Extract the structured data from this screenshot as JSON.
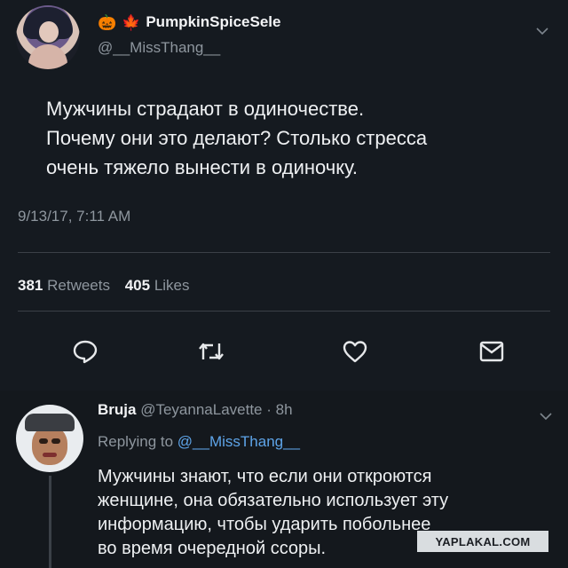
{
  "tweet": {
    "emoji_1": "🎃",
    "emoji_2": "🍁",
    "display_name": "PumpkinSpiceSele",
    "handle": "@__MissThang__",
    "text_lines": [
      "Мужчины страдают в одиночестве.",
      "Почему они это делают? Столько стресса",
      "очень тяжело вынести в одиночку."
    ],
    "timestamp": "9/13/17, 7:11 AM",
    "retweets_count": "381",
    "retweets_label": "Retweets",
    "likes_count": "405",
    "likes_label": "Likes",
    "actions": [
      "reply-icon",
      "retweet-icon",
      "like-icon",
      "message-icon"
    ],
    "menu_icon": "chevron-down-icon"
  },
  "reply": {
    "display_name": "Bruja",
    "handle": "@TeyannaLavette",
    "separator": "·",
    "time": "8h",
    "replying_to_label": "Replying to",
    "replying_to_mention": "@__MissThang__",
    "text_lines": [
      "Мужчины знают, что если они откроются",
      "женщине, она обязательно использует эту",
      "информацию, чтобы ударить побольнее",
      "во время очередной ссоры."
    ],
    "menu_icon": "chevron-down-icon"
  },
  "watermark": "YAPLAKAL.COM",
  "colors": {
    "background": "#151a20",
    "text": "#eef0f2",
    "muted": "#8e969e",
    "link": "#5ea4e8",
    "divider": "#3b4047"
  }
}
